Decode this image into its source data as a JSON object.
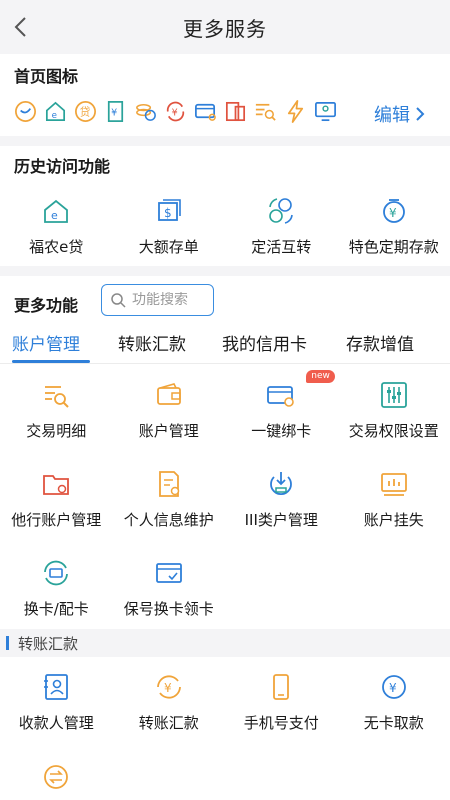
{
  "header": {
    "title": "更多服务"
  },
  "home_icons": {
    "title": "首页图标",
    "icons": [
      "smile-circle-icon",
      "house-e-icon",
      "loan-circle-icon",
      "receipt-icon",
      "coins-stack-icon",
      "yen-refresh-icon",
      "card-link-icon",
      "document-pages-icon",
      "list-search-icon",
      "lightning-icon",
      "monitor-person-icon"
    ],
    "edit_label": "编辑"
  },
  "history": {
    "title": "历史访问功能",
    "items": [
      {
        "label": "福农e贷",
        "icon": "house-e-icon"
      },
      {
        "label": "大额存单",
        "icon": "dollar-doc-icon"
      },
      {
        "label": "定活互转",
        "icon": "coin-exchange-icon"
      },
      {
        "label": "特色定期存款",
        "icon": "yen-deposit-icon"
      }
    ]
  },
  "more": {
    "title": "更多功能",
    "search_placeholder": "功能搜索",
    "tabs": [
      "账户管理",
      "转账汇款",
      "我的信用卡",
      "存款增值"
    ],
    "active_tab": 0,
    "account_items": [
      {
        "label": "交易明细",
        "icon": "list-search-icon"
      },
      {
        "label": "账户管理",
        "icon": "wallet-icon"
      },
      {
        "label": "一键绑卡",
        "icon": "card-link-icon",
        "badge": "new"
      },
      {
        "label": "交易权限设置",
        "icon": "sliders-icon"
      },
      {
        "label": "他行账户管理",
        "icon": "folder-gear-icon"
      },
      {
        "label": "个人信息维护",
        "icon": "doc-gear-icon"
      },
      {
        "label": "III类户管理",
        "icon": "download-circle-icon"
      },
      {
        "label": "账户挂失",
        "icon": "monitor-chart-icon"
      },
      {
        "label": "换卡/配卡",
        "icon": "card-refresh-icon"
      },
      {
        "label": "保号换卡领卡",
        "icon": "card-check-icon"
      }
    ],
    "transfer_category": "转账汇款",
    "transfer_items": [
      {
        "label": "收款人管理",
        "icon": "contact-book-icon"
      },
      {
        "label": "转账汇款",
        "icon": "yen-refresh-icon"
      },
      {
        "label": "手机号支付",
        "icon": "phone-icon"
      },
      {
        "label": "无卡取款",
        "icon": "yen-circle-icon"
      },
      {
        "label": "",
        "icon": "exchange-circle-icon"
      }
    ]
  },
  "colors": {
    "accent": "#2e7fd9",
    "orange": "#f0a43a",
    "teal": "#2aa39a",
    "red": "#e0533f",
    "background_band": "#f4f4f6"
  }
}
